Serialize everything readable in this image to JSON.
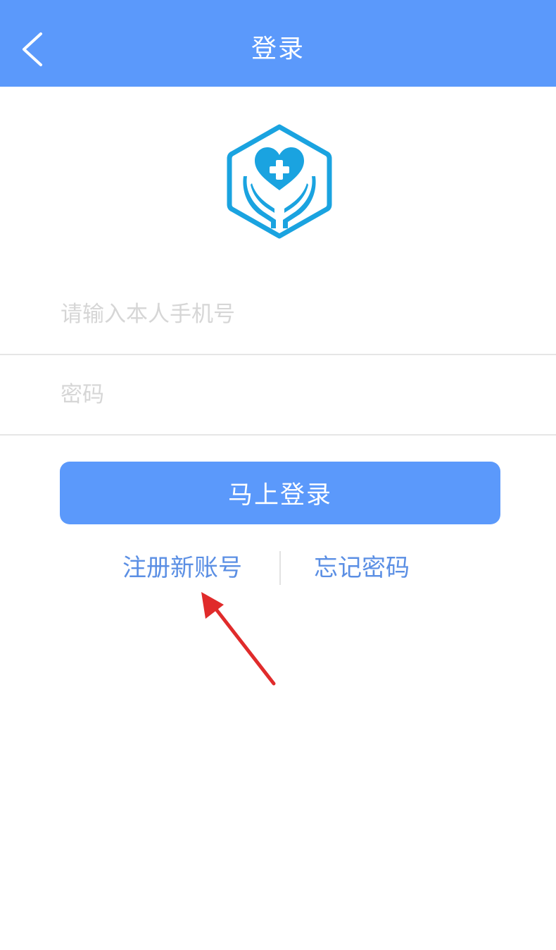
{
  "header": {
    "title": "登录",
    "back_icon": "chevron-left-icon",
    "background": "#5b99fb"
  },
  "logo": {
    "icon": "heart-cross-hands-icon",
    "color": "#1aa3e0"
  },
  "form": {
    "phone_placeholder": "请输入本人手机号",
    "phone_value": "",
    "password_placeholder": "密码",
    "password_value": ""
  },
  "login_button": {
    "label": "马上登录"
  },
  "links": {
    "register_label": "注册新账号",
    "forgot_label": "忘记密码"
  },
  "annotation": {
    "arrow_color": "#e02b2b"
  }
}
